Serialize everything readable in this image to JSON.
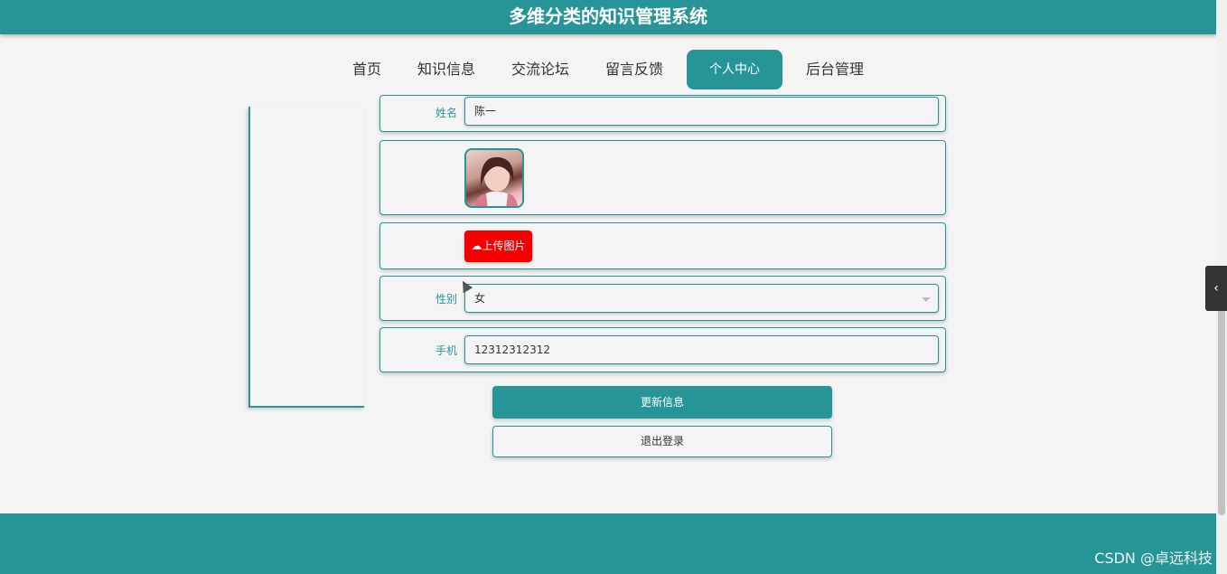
{
  "header": {
    "title": "多维分类的知识管理系统"
  },
  "nav": {
    "items": [
      {
        "label": "首页"
      },
      {
        "label": "知识信息"
      },
      {
        "label": "交流论坛"
      },
      {
        "label": "留言反馈"
      },
      {
        "label": "个人中心",
        "active": true
      },
      {
        "label": "后台管理"
      }
    ]
  },
  "form": {
    "name": {
      "label": "姓名",
      "value": "陈一"
    },
    "avatar": {
      "icon": "avatar-photo"
    },
    "upload": {
      "label": "上传图片",
      "icon": "cloud-upload-icon"
    },
    "gender": {
      "label": "性别",
      "value": "女"
    },
    "phone": {
      "label": "手机",
      "value": "12312312312"
    }
  },
  "actions": {
    "update_label": "更新信息",
    "logout_label": "退出登录"
  },
  "side_toggle": {
    "icon": "chevron-left-icon",
    "glyph": "‹"
  },
  "watermark": "CSDN @卓远科技",
  "colors": {
    "primary": "#279597",
    "danger": "#f40000",
    "background": "#f4f4f4"
  }
}
